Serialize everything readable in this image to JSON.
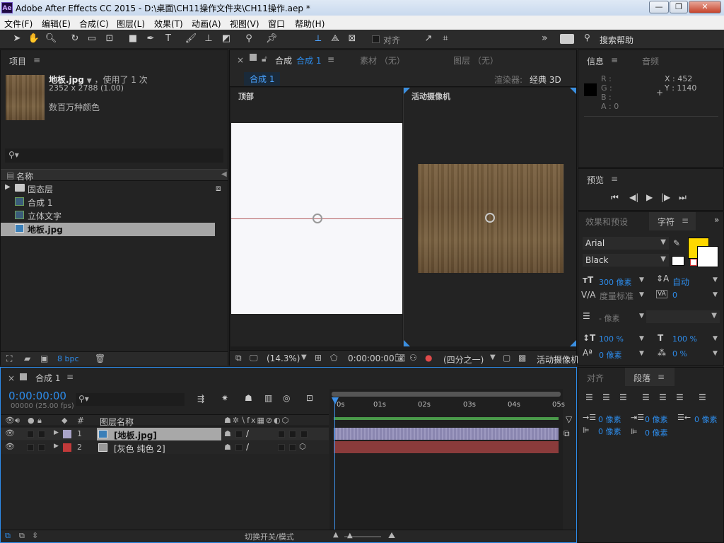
{
  "window": {
    "logo": "Ae",
    "title": "Adobe After Effects CC 2015 - D:\\桌面\\CH11操作文件夹\\CH11操作.aep *",
    "min": "—",
    "max": "❐",
    "close": "✕"
  },
  "menu": [
    "文件(F)",
    "编辑(E)",
    "合成(C)",
    "图层(L)",
    "效果(T)",
    "动画(A)",
    "视图(V)",
    "窗口",
    "帮助(H)"
  ],
  "toolbar": {
    "align_label": "对齐",
    "search_help": "搜索帮助",
    "more": "»"
  },
  "project": {
    "tab": "项目",
    "file_name": "地板.jpg",
    "used": "，使用了 1 次",
    "dimensions": "2352 x 2788 (1.00)",
    "colors": "数百万种颜色",
    "column_name": "名称",
    "items": [
      {
        "name": "固态层",
        "type": "folder"
      },
      {
        "name": "合成 1",
        "type": "comp"
      },
      {
        "name": "立体文字",
        "type": "comp"
      },
      {
        "name": "地板.jpg",
        "type": "image"
      }
    ],
    "bpc": "8 bpc"
  },
  "composition": {
    "tab_prefix": "合成",
    "tab_name": "合成 1",
    "footage_tab": "素材 （无）",
    "layer_tab": "图层 （无）",
    "sub_tab": "合成 1",
    "renderer_label": "渲染器:",
    "renderer_value": "经典 3D",
    "view_left": "顶部",
    "view_right": "活动摄像机",
    "zoom": "(14.3%)",
    "timecode": "0:00:00:00",
    "resolution": "(四分之一)",
    "camera": "活动摄像机"
  },
  "info": {
    "tab": "信息",
    "audio_tab": "音频",
    "r": "R :",
    "g": "G :",
    "b": "B :",
    "a": "A : 0",
    "x": "X : 452",
    "y": "Y : 1140"
  },
  "preview": {
    "tab": "预览"
  },
  "character": {
    "effects_tab": "效果和预设",
    "tab": "字符",
    "font": "Arial",
    "style": "Black",
    "size": "300 像素",
    "leading": "自动",
    "kerning": "度量标准",
    "tracking": "0",
    "stroke": "- 像素",
    "vscale": "100 %",
    "hscale": "100 %",
    "baseline": "0 像素",
    "tsume": "0 %",
    "fill_color": "#ffd800"
  },
  "paragraph": {
    "align_tab": "对齐",
    "tab": "段落",
    "indent_left": "0 像素",
    "indent_first": "0 像素",
    "indent_right": "0 像素",
    "space_before": "0 像素",
    "space_after": "0 像素"
  },
  "timeline": {
    "tab": "合成 1",
    "timecode": "0:00:00:00",
    "frames": "00000 (25.00 fps)",
    "col_num": "#",
    "col_name": "图层名称",
    "ticks": [
      "0s",
      "01s",
      "02s",
      "03s",
      "04s",
      "05s"
    ],
    "layers": [
      {
        "num": "1",
        "name": "[地板.jpg]",
        "color": "#a9a4c8",
        "bar": "#8a86b0"
      },
      {
        "num": "2",
        "name": "[灰色 纯色 2]",
        "color": "#c23a3a",
        "bar": "#8a3b3b"
      }
    ],
    "toggle_label": "切换开关/模式"
  }
}
